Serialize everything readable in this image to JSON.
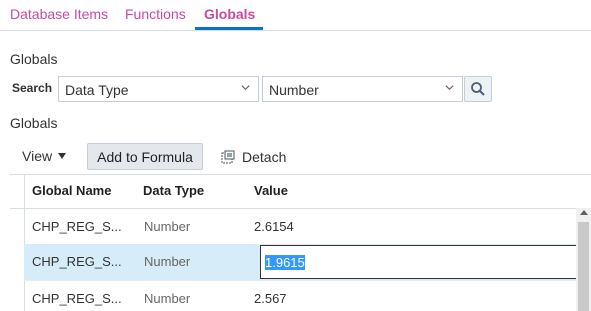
{
  "tabs": [
    {
      "label": "Database Items",
      "active": false
    },
    {
      "label": "Functions",
      "active": false
    },
    {
      "label": "Globals",
      "active": true
    }
  ],
  "colors": {
    "tab_text": "#c74ba3",
    "active_underline": "#0572ce",
    "selected_row": "#d6ecf8",
    "text_selection": "#3399ff"
  },
  "section_title": "Globals",
  "search": {
    "label": "Search",
    "field_value": "Data Type",
    "operator_value": "Number",
    "button_icon": "search-icon"
  },
  "results_title": "Globals",
  "toolbar": {
    "view_label": "View",
    "add_label": "Add to Formula",
    "detach_label": "Detach",
    "detach_icon": "detach-icon"
  },
  "table": {
    "columns": [
      "Global Name",
      "Data Type",
      "Value"
    ],
    "rows": [
      {
        "name": "CHP_REG_S...",
        "type": "Number",
        "value": "2.6154",
        "selected": false
      },
      {
        "name": "CHP_REG_S...",
        "type": "Number",
        "value": "1.9615",
        "selected": true
      },
      {
        "name": "CHP_REG_S...",
        "type": "Number",
        "value": "2.567",
        "selected": false
      }
    ]
  }
}
